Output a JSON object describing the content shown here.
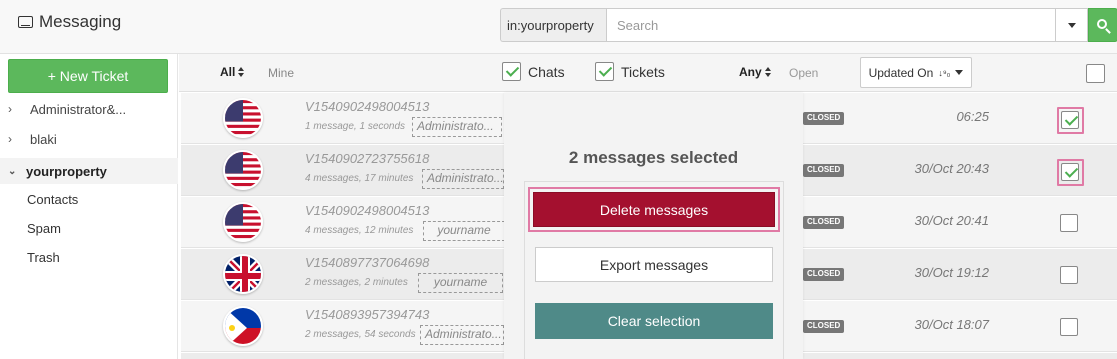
{
  "app": {
    "title": "Messaging",
    "icon": "inbox-icon"
  },
  "search": {
    "prefix": "in:yourproperty",
    "placeholder": "Search",
    "value": ""
  },
  "sidebar": {
    "new_ticket_label": "+ New Ticket",
    "items": [
      {
        "label": "Administrator&...",
        "expanded": false
      },
      {
        "label": "blaki",
        "expanded": false
      },
      {
        "label": "yourproperty",
        "expanded": true,
        "active": true
      }
    ],
    "subitems": [
      "Contacts",
      "Spam",
      "Trash"
    ]
  },
  "filters": {
    "all_label": "All",
    "mine_label": "Mine",
    "chats_label": "Chats",
    "chats_checked": true,
    "tickets_label": "Tickets",
    "tickets_checked": true,
    "any_label": "Any",
    "open_label": "Open",
    "sort_label": "Updated On",
    "select_all_checked": false
  },
  "rows": [
    {
      "id": "V1540902498004513",
      "meta": "1 message, 1 seconds",
      "tag": "Administrato...",
      "status": "CLOSED",
      "time": "06:25",
      "flag": "us",
      "checked": true
    },
    {
      "id": "V1540902723755618",
      "meta": "4 messages, 17 minutes",
      "tag": "Administrato...",
      "status": "CLOSED",
      "time": "30/Oct 20:43",
      "flag": "us",
      "checked": true
    },
    {
      "id": "V1540902498004513",
      "meta": "4 messages, 12 minutes",
      "tag": "yourname",
      "status": "CLOSED",
      "time": "30/Oct 20:41",
      "flag": "us",
      "checked": false
    },
    {
      "id": "V1540897737064698",
      "meta": "2 messages, 2 minutes",
      "tag": "yourname",
      "status": "CLOSED",
      "time": "30/Oct 19:12",
      "flag": "gb",
      "checked": false
    },
    {
      "id": "V1540893957394743",
      "meta": "2 messages, 54 seconds",
      "tag": "Administrato...",
      "status": "CLOSED",
      "time": "30/Oct 18:07",
      "flag": "ph",
      "checked": false
    }
  ],
  "selection": {
    "title": "2 messages selected",
    "delete_label": "Delete messages",
    "export_label": "Export messages",
    "clear_label": "Clear selection"
  },
  "colors": {
    "accent_green": "#5cb85c",
    "delete_red": "#a4102f",
    "clear_teal": "#4f8a88",
    "highlight_pink": "#e07aa5"
  }
}
